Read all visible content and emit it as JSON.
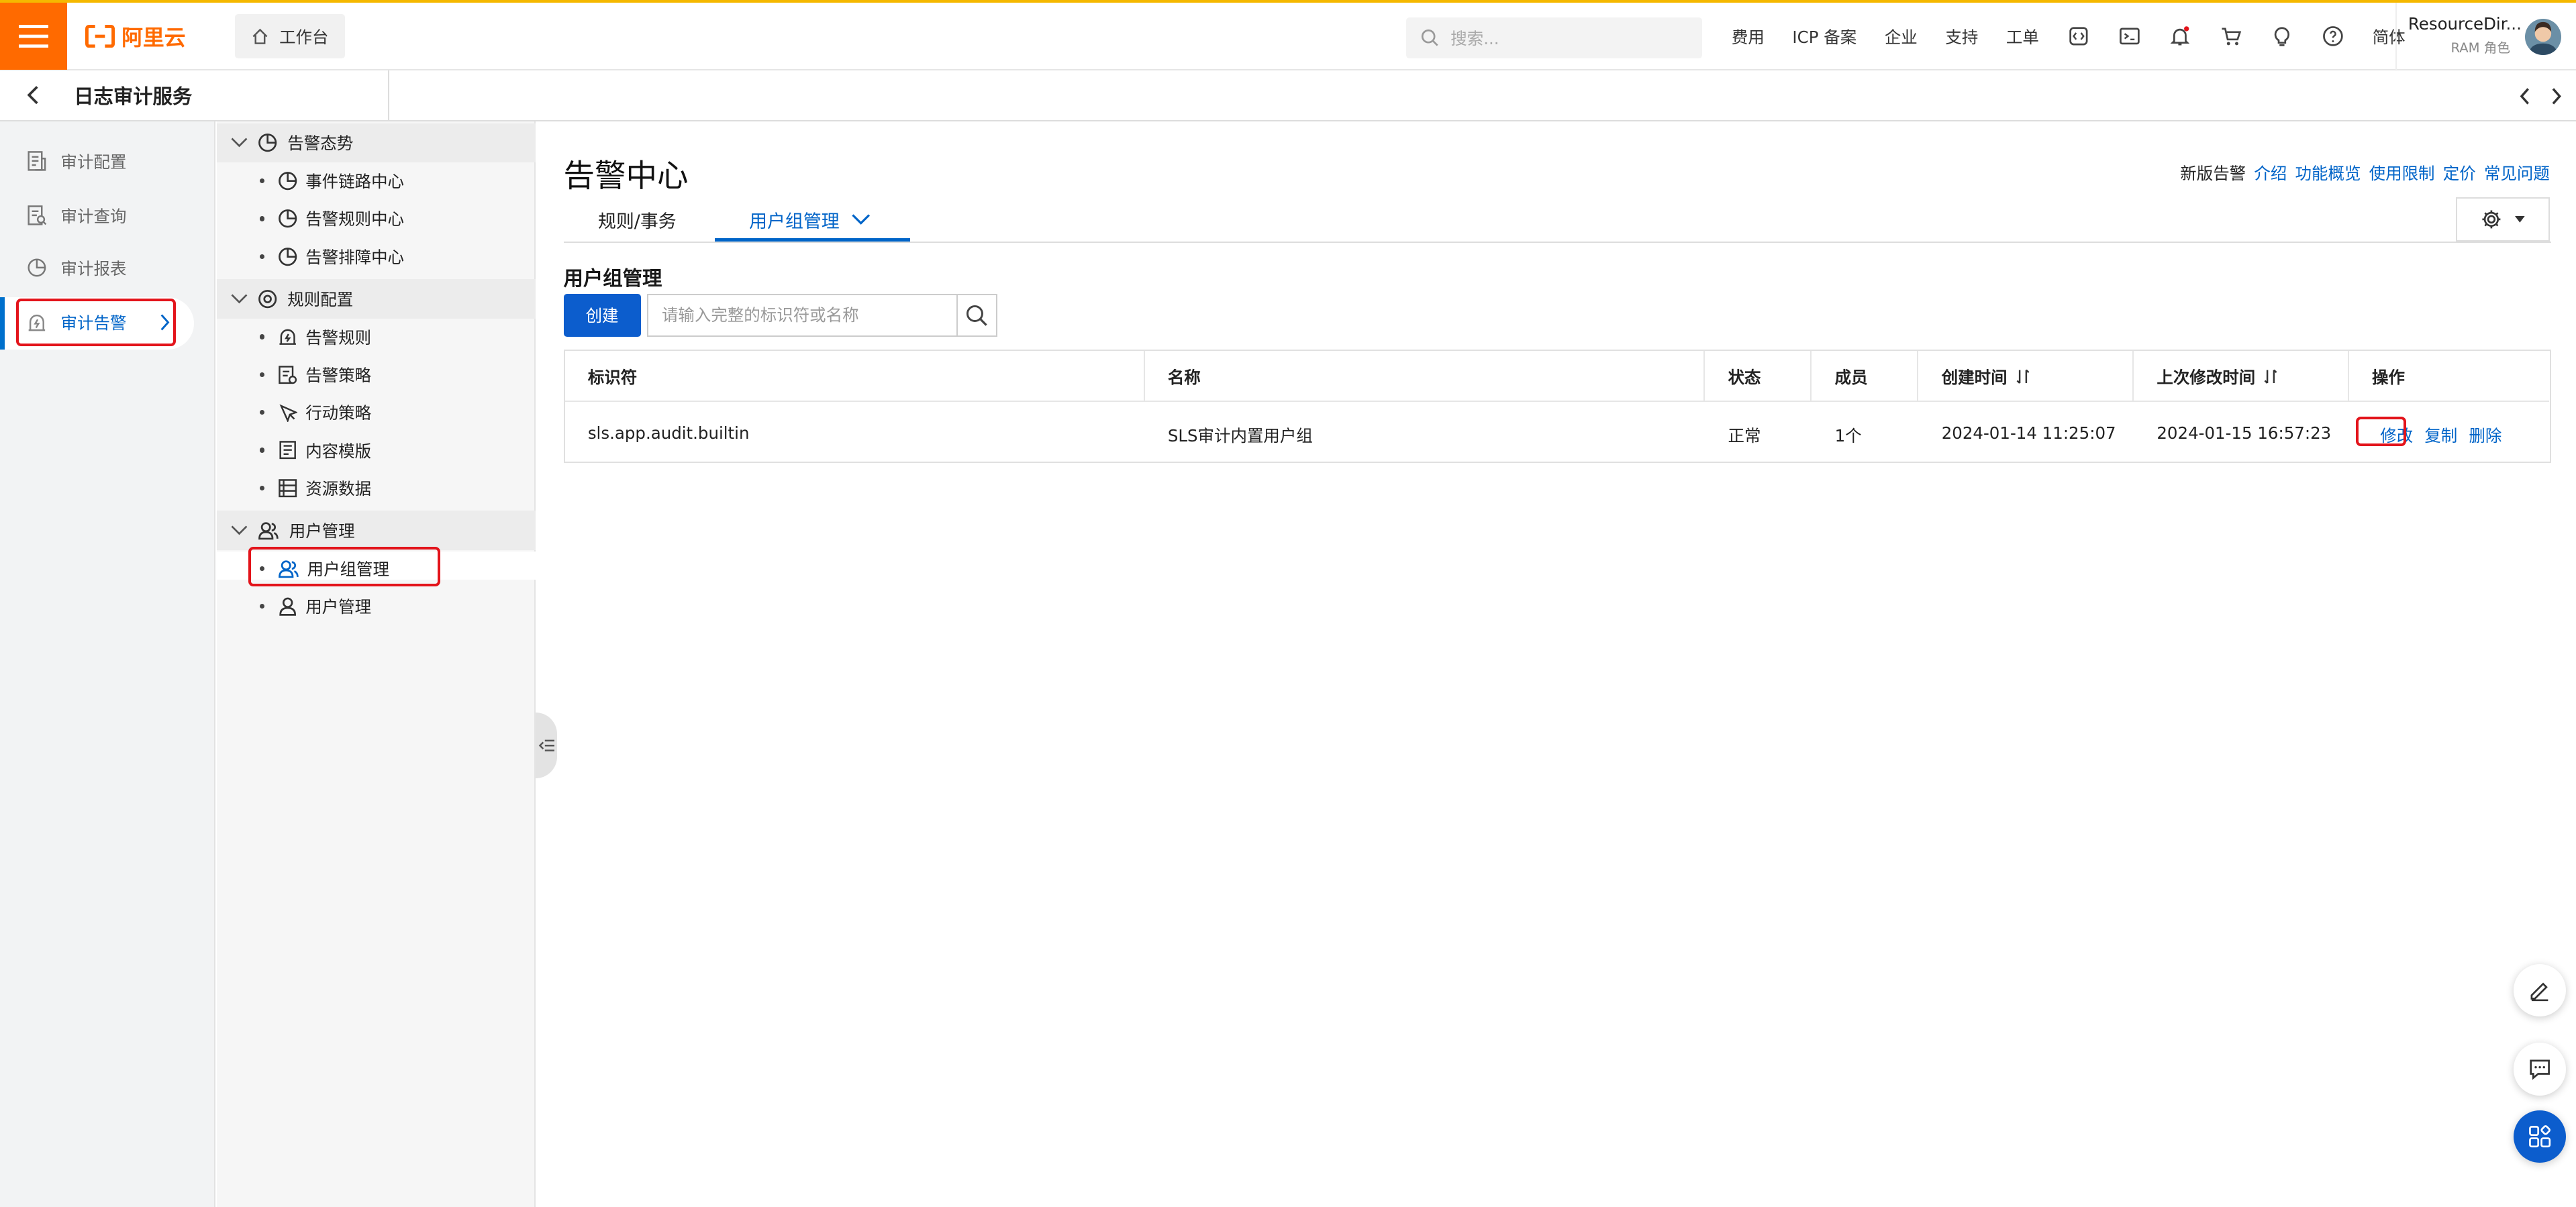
{
  "header": {
    "logo_text": "阿里云",
    "workbench": "工作台",
    "search_placeholder": "搜索...",
    "nav": [
      "费用",
      "ICP 备案",
      "企业",
      "支持",
      "工单"
    ],
    "lang": "简体",
    "account_name": "ResourceDir...",
    "account_role": "RAM 角色"
  },
  "service": {
    "title": "日志审计服务"
  },
  "left_nav": [
    {
      "label": "审计配置",
      "icon": "config-doc-icon"
    },
    {
      "label": "审计查询",
      "icon": "query-doc-icon"
    },
    {
      "label": "审计报表",
      "icon": "pie-report-icon"
    },
    {
      "label": "审计告警",
      "icon": "alarm-icon",
      "active": true
    }
  ],
  "sub_nav": {
    "groups": [
      {
        "label": "告警态势",
        "items": [
          "事件链路中心",
          "告警规则中心",
          "告警排障中心"
        ]
      },
      {
        "label": "规则配置",
        "items": [
          "告警规则",
          "告警策略",
          "行动策略",
          "内容模版",
          "资源数据"
        ]
      },
      {
        "label": "用户管理",
        "items": [
          "用户组管理",
          "用户管理"
        ]
      }
    ],
    "active_item": "用户组管理"
  },
  "main": {
    "title": "告警中心",
    "links": {
      "new": "新版告警",
      "intro": "介绍",
      "overview": "功能概览",
      "limits": "使用限制",
      "pricing": "定价",
      "faq": "常见问题"
    },
    "tabs": [
      "规则/事务",
      "用户组管理"
    ],
    "active_tab": "用户组管理",
    "section_title": "用户组管理",
    "create_label": "创建",
    "search_placeholder": "请输入完整的标识符或名称"
  },
  "table": {
    "columns": [
      "标识符",
      "名称",
      "状态",
      "成员",
      "创建时间",
      "上次修改时间",
      "操作"
    ],
    "rows": [
      {
        "id": "sls.app.audit.builtin",
        "name": "SLS审计内置用户组",
        "status": "正常",
        "members": "1个",
        "created": "2024-01-14 11:25:07",
        "modified": "2024-01-15 16:57:23",
        "actions": [
          "修改",
          "复制",
          "删除"
        ]
      }
    ]
  },
  "colors": {
    "brand": "#ff6a00",
    "primary": "#0c5dcd",
    "link": "#0064c8",
    "highlight": "#e3141b"
  }
}
